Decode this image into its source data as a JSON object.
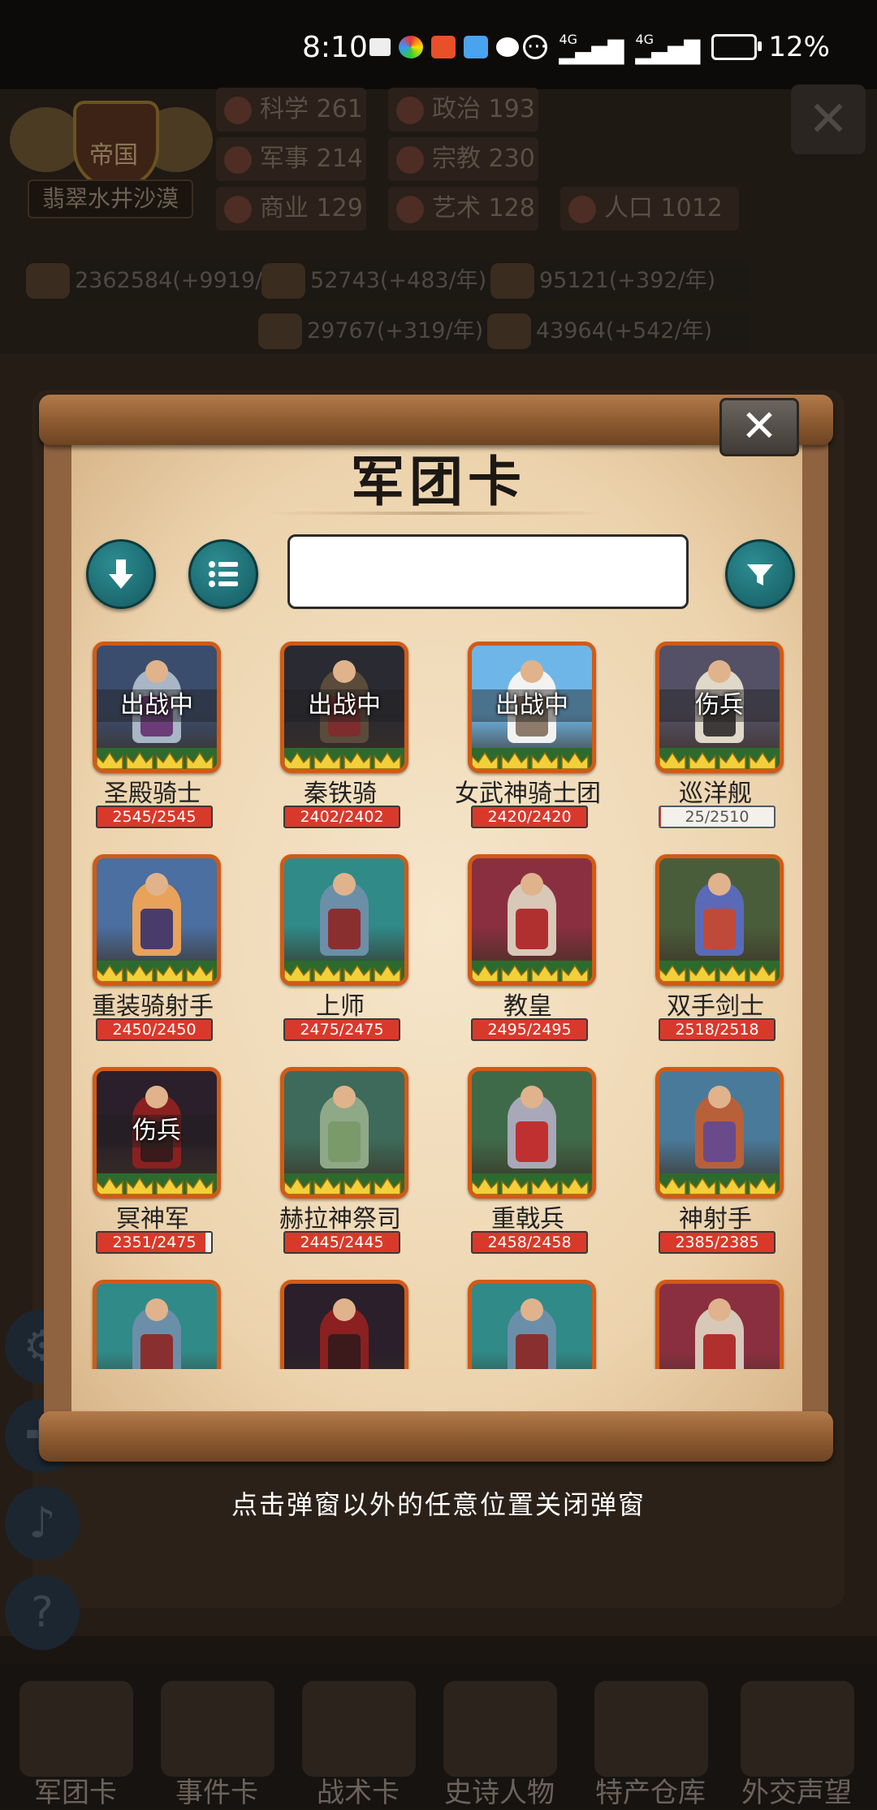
{
  "status_bar": {
    "time": "8:10",
    "battery": "12%",
    "notification_icons": [
      "mail-icon",
      "color-app-icon",
      "red-app-icon",
      "blue-app-icon",
      "chat-icon",
      "more-icon"
    ],
    "right_icons": [
      "alarm-icon",
      "signal-4g-icon",
      "signal-4g-icon",
      "battery-icon"
    ]
  },
  "background": {
    "empire": {
      "title": "帝国",
      "name": "翡翠水井沙漠"
    },
    "stats": [
      {
        "label": "科学 261",
        "icon": "science-icon"
      },
      {
        "label": "政治 193",
        "icon": "politics-icon"
      },
      {
        "label": "军事 214",
        "icon": "military-icon"
      },
      {
        "label": "宗教 230",
        "icon": "religion-icon"
      },
      {
        "label": "商业 129",
        "icon": "commerce-icon"
      },
      {
        "label": "艺术 128",
        "icon": "art-icon"
      },
      {
        "label": "人口 1012",
        "icon": "population-icon"
      }
    ],
    "resources": [
      "2362584(+9919/年)",
      "52743(+483/年)",
      "95121(+392/年)",
      "29767(+319/年)",
      "43964(+542/年)"
    ],
    "side_icons": [
      "gear-icon",
      "cross-icon",
      "mute-icon",
      "help-icon"
    ],
    "bottom_nav": [
      "军团卡",
      "事件卡",
      "战术卡",
      "史诗人物",
      "特产仓库",
      "外交声望"
    ]
  },
  "modal": {
    "title": "军团卡",
    "search": {
      "value": "",
      "placeholder": ""
    },
    "buttons": [
      "arrow-down-icon",
      "list-icon",
      "filter-icon"
    ],
    "cards": [
      {
        "name": "圣殿骑士",
        "hp": "2545/2545",
        "hp_ratio": 1.0,
        "badge": "出战中"
      },
      {
        "name": "秦铁骑",
        "hp": "2402/2402",
        "hp_ratio": 1.0,
        "badge": "出战中"
      },
      {
        "name": "女武神骑士团",
        "hp": "2420/2420",
        "hp_ratio": 1.0,
        "badge": "出战中"
      },
      {
        "name": "巡洋舰",
        "hp": "25/2510",
        "hp_ratio": 0.01,
        "badge": "伤兵"
      },
      {
        "name": "重装骑射手",
        "hp": "2450/2450",
        "hp_ratio": 1.0,
        "badge": ""
      },
      {
        "name": "上师",
        "hp": "2475/2475",
        "hp_ratio": 1.0,
        "badge": ""
      },
      {
        "name": "教皇",
        "hp": "2495/2495",
        "hp_ratio": 1.0,
        "badge": ""
      },
      {
        "name": "双手剑士",
        "hp": "2518/2518",
        "hp_ratio": 1.0,
        "badge": ""
      },
      {
        "name": "冥神军",
        "hp": "2351/2475",
        "hp_ratio": 0.95,
        "badge": "伤兵"
      },
      {
        "name": "赫拉神祭司",
        "hp": "2445/2445",
        "hp_ratio": 1.0,
        "badge": ""
      },
      {
        "name": "重戟兵",
        "hp": "2458/2458",
        "hp_ratio": 1.0,
        "badge": ""
      },
      {
        "name": "神射手",
        "hp": "2385/2385",
        "hp_ratio": 1.0,
        "badge": ""
      },
      {
        "name": "",
        "hp": "",
        "hp_ratio": 1.0,
        "badge": ""
      },
      {
        "name": "",
        "hp": "",
        "hp_ratio": 1.0,
        "badge": ""
      },
      {
        "name": "",
        "hp": "",
        "hp_ratio": 1.0,
        "badge": ""
      },
      {
        "name": "",
        "hp": "",
        "hp_ratio": 1.0,
        "badge": ""
      }
    ]
  },
  "hint": "点击弹窗以外的任意位置关闭弹窗"
}
